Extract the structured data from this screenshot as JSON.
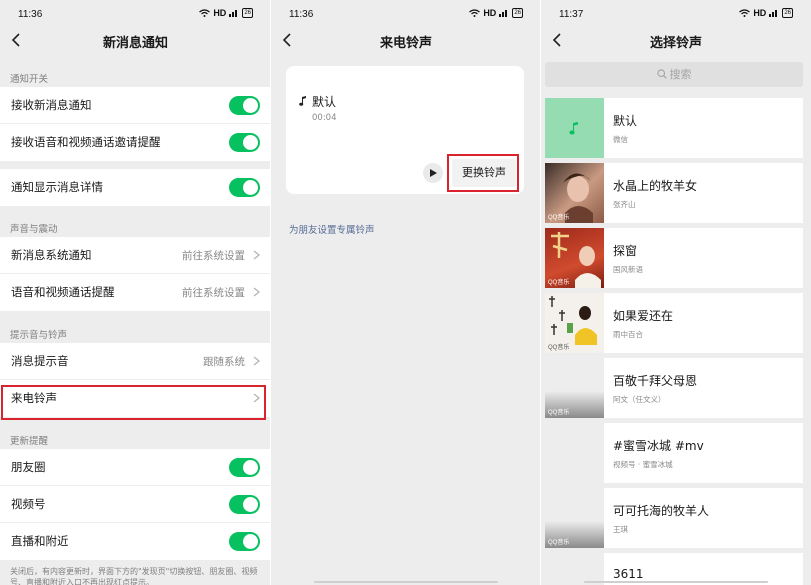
{
  "status_bars": [
    {
      "time": "11:36",
      "network": "HD",
      "signal": "4G",
      "battery": "26"
    },
    {
      "time": "11:36",
      "network": "HD",
      "signal": "4G",
      "battery": "26"
    },
    {
      "time": "11:37",
      "network": "HD",
      "signal": "4G",
      "battery": "26"
    }
  ],
  "panel1": {
    "title": "新消息通知",
    "sections": {
      "notify": "通知开关",
      "sound": "声音与震动",
      "tones": "提示音与铃声",
      "updates": "更新提醒"
    },
    "rows": {
      "receive_new": "接收新消息通知",
      "receive_call": "接收语音和视频通话邀请提醒",
      "show_detail": "通知显示消息详情",
      "sys_notify": "新消息系统通知",
      "sys_notify_value": "前往系统设置",
      "call_remind": "语音和视频通话提醒",
      "call_remind_value": "前往系统设置",
      "msg_tone": "消息提示音",
      "msg_tone_value": "跟随系统",
      "ringtone": "来电铃声",
      "moments": "朋友圈",
      "channels": "视频号",
      "live_nearby": "直播和附近"
    },
    "toggles": {
      "receive_new": true,
      "receive_call": true,
      "show_detail": true,
      "moments": true,
      "channels": true,
      "live_nearby": true
    },
    "footnote": "关闭后，有内容更新时，界面下方的\"发现页\"切换按钮、朋友圈、视频号、直播和附近入口不再出现红点提示。"
  },
  "panel2": {
    "title": "来电铃声",
    "current_name": "默认",
    "current_duration": "00:04",
    "change_button": "更换铃声",
    "friend_link": "为朋友设置专属铃声"
  },
  "panel3": {
    "title": "选择铃声",
    "search_placeholder": "搜索",
    "qq_tag": "QQ音乐",
    "items": [
      {
        "title": "默认",
        "subtitle": "微信"
      },
      {
        "title": "水晶上的牧羊女",
        "subtitle": "张齐山"
      },
      {
        "title": "探窗",
        "subtitle": "国风新语"
      },
      {
        "title": "如果爱还在",
        "subtitle": "雨中百合"
      },
      {
        "title": "百敬千拜父母恩",
        "subtitle": "阿文（任文义）"
      },
      {
        "title": "#蜜雪冰城 #mv",
        "subtitle": "视频号 · 蜜雪冰城"
      },
      {
        "title": "可可托海的牧羊人",
        "subtitle": "王琪"
      },
      {
        "title": "3611",
        "subtitle": ""
      }
    ]
  },
  "colors": {
    "accent": "#07c160",
    "highlight": "#d9232e",
    "link": "#576b95"
  }
}
